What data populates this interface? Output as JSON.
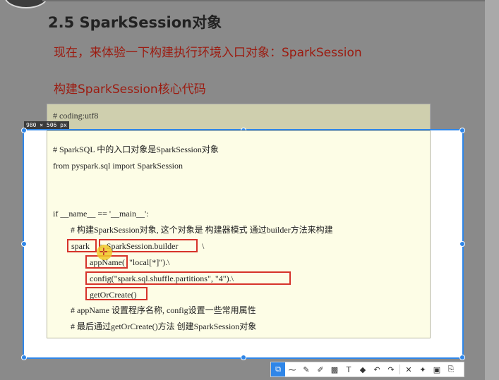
{
  "slide": {
    "title": "2.5 SparkSession对象",
    "subtitle1": "现在，来体验一下构建执行环境入口对象：SparkSession",
    "subtitle2": "构建SparkSession核心代码"
  },
  "code_behind": "# coding:utf8",
  "selection_label": "980 × 506 px",
  "code": {
    "line1": "# SparkSQL 中的入口对象是SparkSession对象",
    "line2": "from pyspark.sql import SparkSession",
    "line3": "if __name__ == '__main__':",
    "line4": "# 构建SparkSession对象, 这个对象是 构建器模式 通过builder方法来构建",
    "line5_a": "spark",
    "line5_b": " = SparkSession.builder",
    "line5_c": " \\",
    "line6_a": "appName(",
    "line6_b": "\"local[*]\").\\",
    "line7": "config(\"spark.sql.shuffle.partitions\", \"4\").\\",
    "line8": "getOrCreate()",
    "line9": "# appName 设置程序名称, config设置一些常用属性",
    "line10": "# 最后通过getOrCreate()方法 创建SparkSession对象"
  },
  "toolbar": {
    "icons": [
      "select-icon",
      "line-icon",
      "pen-icon",
      "marker-icon",
      "mosaic-icon",
      "text-icon",
      "eraser-icon",
      "undo-icon",
      "redo-icon",
      "close-icon",
      "pin-icon",
      "save-icon",
      "copy-icon"
    ],
    "glyphs": [
      "⧉",
      "⁓",
      "✎",
      "✐",
      "▩",
      "T",
      "◆",
      "↶",
      "↷",
      "✕",
      "✦",
      "▣",
      "⎘"
    ]
  },
  "colors": {
    "accent": "#2f86e8",
    "annotation": "#d6332a",
    "subtitle": "#9c1b10"
  }
}
